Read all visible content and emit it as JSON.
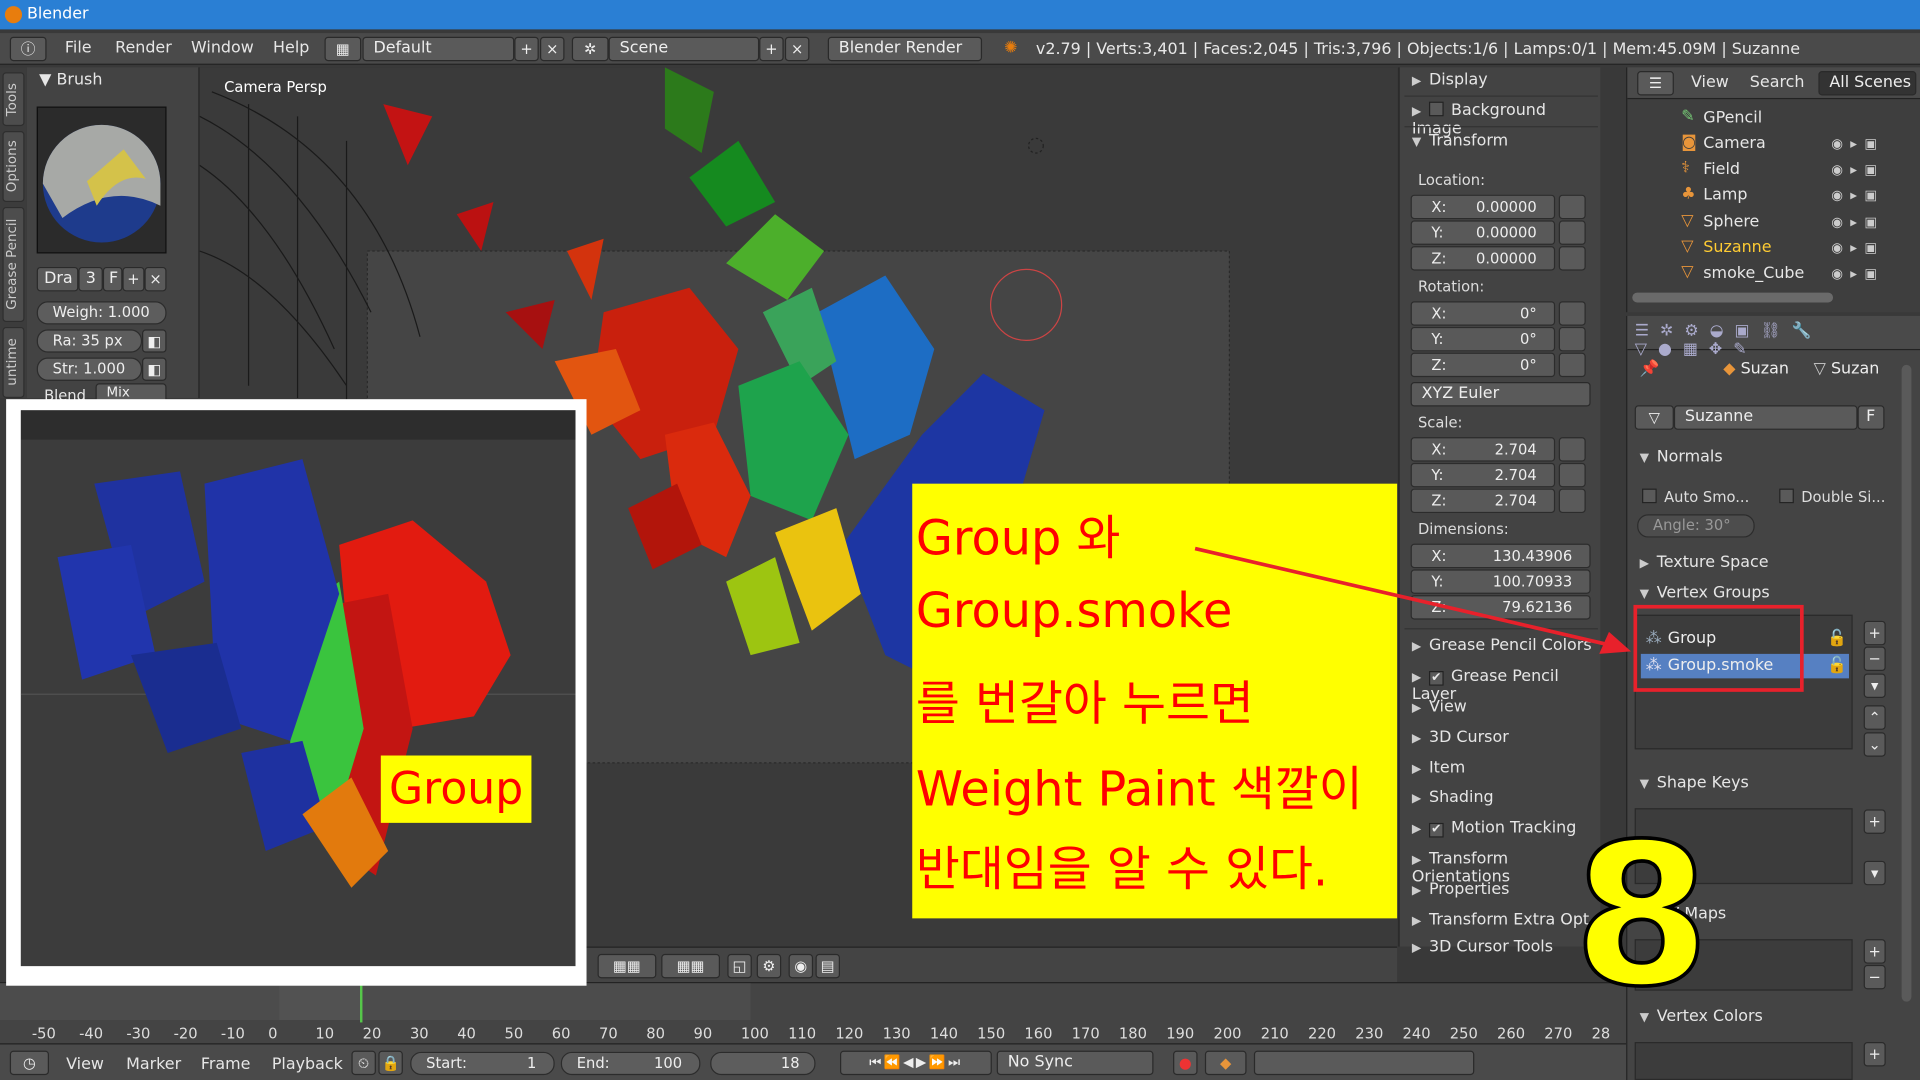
{
  "window": {
    "title": "Blender"
  },
  "menubar": {
    "menus": [
      "File",
      "Render",
      "Window",
      "Help"
    ],
    "screen_layout": "Default",
    "scene": "Scene",
    "render_engine": "Blender Render",
    "stats": "v2.79 | Verts:3,401 | Faces:2,045 | Tris:3,796 | Objects:1/6 | Lamps:0/1 | Mem:45.09M | Suzanne"
  },
  "toolshelf": {
    "tabs": [
      "Tools",
      "Options",
      "Grease Pencil",
      "untime"
    ],
    "brush_header": "Brush",
    "brush_name": "Dra",
    "brush_users": "3",
    "brush_fake": "F",
    "weight": "Weigh: 1.000",
    "radius": "Ra: 35 px",
    "strength": "Str: 1.000",
    "blend_label": "Blend",
    "blend_value": "Mix"
  },
  "viewport": {
    "label": "Camera Persp"
  },
  "properties_panel": {
    "display": "Display",
    "background_images": "Background Image",
    "transform": "Transform",
    "location_label": "Location:",
    "location": [
      {
        "k": "X:",
        "v": "0.00000"
      },
      {
        "k": "Y:",
        "v": "0.00000"
      },
      {
        "k": "Z:",
        "v": "0.00000"
      }
    ],
    "rotation_label": "Rotation:",
    "rotation": [
      {
        "k": "X:",
        "v": "0°"
      },
      {
        "k": "Y:",
        "v": "0°"
      },
      {
        "k": "Z:",
        "v": "0°"
      }
    ],
    "rotation_mode": "XYZ Euler",
    "scale_label": "Scale:",
    "scale": [
      {
        "k": "X:",
        "v": "2.704"
      },
      {
        "k": "Y:",
        "v": "2.704"
      },
      {
        "k": "Z:",
        "v": "2.704"
      }
    ],
    "dimensions_label": "Dimensions:",
    "dimensions": [
      {
        "k": "X:",
        "v": "130.43906"
      },
      {
        "k": "Y:",
        "v": "100.70933"
      },
      {
        "k": "Z:",
        "v": "79.62136"
      }
    ],
    "sections": [
      "Grease Pencil Colors",
      "Grease Pencil Layer",
      "View",
      "3D Cursor",
      "Item",
      "Shading",
      "Motion Tracking",
      "Transform Orientations",
      "Properties",
      "Transform Extra Opt",
      "3D Cursor Tools"
    ]
  },
  "outliner": {
    "view": "View",
    "search": "Search",
    "filter": "All Scenes",
    "items": [
      "GPencil",
      "Camera",
      "Field",
      "Lamp",
      "Sphere",
      "Suzanne",
      "smoke_Cube"
    ]
  },
  "data_panel": {
    "breadcrumb": [
      "Suzan",
      "Suzan"
    ],
    "mesh_name": "Suzanne",
    "fake": "F",
    "normals": "Normals",
    "auto_smooth": "Auto Smo...",
    "double_sided": "Double Si...",
    "angle": "Angle: 30°",
    "texture_space": "Texture Space",
    "vertex_groups": "Vertex Groups",
    "groups": [
      "Group",
      "Group.smoke"
    ],
    "shape_keys": "Shape Keys",
    "uv_maps": "UV Maps",
    "vertex_colors": "Vertex Colors"
  },
  "timeline": {
    "ticks": [
      "-50",
      "-40",
      "-30",
      "-20",
      "-10",
      "0",
      "10",
      "20",
      "30",
      "40",
      "50",
      "60",
      "70",
      "80",
      "90",
      "100",
      "110",
      "120",
      "130",
      "140",
      "150",
      "160",
      "170",
      "180",
      "190",
      "200",
      "210",
      "220",
      "230",
      "240",
      "250",
      "260",
      "270",
      "28"
    ],
    "menus": [
      "View",
      "Marker",
      "Frame",
      "Playback"
    ],
    "start": "Start:",
    "start_value": "1",
    "end": "End:",
    "end_value": "100",
    "current": "18",
    "sync": "No Sync"
  },
  "overlays": {
    "group_tag": "Group",
    "annotation_lines": [
      "Group 와",
      "Group.smoke",
      "를 번갈아 누르면",
      "Weight Paint 색깔이",
      "반대임을 알 수 있다."
    ],
    "step_number": "8"
  },
  "colors": {
    "accent": "#2a7fd4",
    "selected": "#5680c2",
    "annotation_bg": "#ffff00",
    "annotation_text": "#ff0000",
    "highlight": "#e8212b"
  }
}
